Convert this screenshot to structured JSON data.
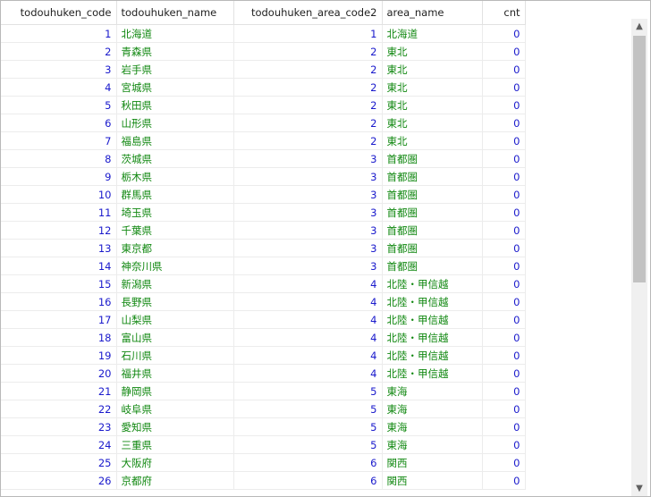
{
  "columns": [
    {
      "key": "code",
      "label": "todouhuken_code",
      "align": "num"
    },
    {
      "key": "name",
      "label": "todouhuken_name",
      "align": "txt"
    },
    {
      "key": "area_code",
      "label": "todouhuken_area_code2",
      "align": "num"
    },
    {
      "key": "area_name",
      "label": "area_name",
      "align": "txt"
    },
    {
      "key": "cnt",
      "label": "cnt",
      "align": "num"
    }
  ],
  "rows": [
    {
      "code": "1",
      "name": "北海道",
      "area_code": "1",
      "area_name": "北海道",
      "cnt": "0"
    },
    {
      "code": "2",
      "name": "青森県",
      "area_code": "2",
      "area_name": "東北",
      "cnt": "0"
    },
    {
      "code": "3",
      "name": "岩手県",
      "area_code": "2",
      "area_name": "東北",
      "cnt": "0"
    },
    {
      "code": "4",
      "name": "宮城県",
      "area_code": "2",
      "area_name": "東北",
      "cnt": "0"
    },
    {
      "code": "5",
      "name": "秋田県",
      "area_code": "2",
      "area_name": "東北",
      "cnt": "0"
    },
    {
      "code": "6",
      "name": "山形県",
      "area_code": "2",
      "area_name": "東北",
      "cnt": "0"
    },
    {
      "code": "7",
      "name": "福島県",
      "area_code": "2",
      "area_name": "東北",
      "cnt": "0"
    },
    {
      "code": "8",
      "name": "茨城県",
      "area_code": "3",
      "area_name": "首都圏",
      "cnt": "0"
    },
    {
      "code": "9",
      "name": "栃木県",
      "area_code": "3",
      "area_name": "首都圏",
      "cnt": "0"
    },
    {
      "code": "10",
      "name": "群馬県",
      "area_code": "3",
      "area_name": "首都圏",
      "cnt": "0"
    },
    {
      "code": "11",
      "name": "埼玉県",
      "area_code": "3",
      "area_name": "首都圏",
      "cnt": "0"
    },
    {
      "code": "12",
      "name": "千葉県",
      "area_code": "3",
      "area_name": "首都圏",
      "cnt": "0"
    },
    {
      "code": "13",
      "name": "東京都",
      "area_code": "3",
      "area_name": "首都圏",
      "cnt": "0"
    },
    {
      "code": "14",
      "name": "神奈川県",
      "area_code": "3",
      "area_name": "首都圏",
      "cnt": "0"
    },
    {
      "code": "15",
      "name": "新潟県",
      "area_code": "4",
      "area_name": "北陸・甲信越",
      "cnt": "0"
    },
    {
      "code": "16",
      "name": "長野県",
      "area_code": "4",
      "area_name": "北陸・甲信越",
      "cnt": "0"
    },
    {
      "code": "17",
      "name": "山梨県",
      "area_code": "4",
      "area_name": "北陸・甲信越",
      "cnt": "0"
    },
    {
      "code": "18",
      "name": "富山県",
      "area_code": "4",
      "area_name": "北陸・甲信越",
      "cnt": "0"
    },
    {
      "code": "19",
      "name": "石川県",
      "area_code": "4",
      "area_name": "北陸・甲信越",
      "cnt": "0"
    },
    {
      "code": "20",
      "name": "福井県",
      "area_code": "4",
      "area_name": "北陸・甲信越",
      "cnt": "0"
    },
    {
      "code": "21",
      "name": "静岡県",
      "area_code": "5",
      "area_name": "東海",
      "cnt": "0"
    },
    {
      "code": "22",
      "name": "岐阜県",
      "area_code": "5",
      "area_name": "東海",
      "cnt": "0"
    },
    {
      "code": "23",
      "name": "愛知県",
      "area_code": "5",
      "area_name": "東海",
      "cnt": "0"
    },
    {
      "code": "24",
      "name": "三重県",
      "area_code": "5",
      "area_name": "東海",
      "cnt": "0"
    },
    {
      "code": "25",
      "name": "大阪府",
      "area_code": "6",
      "area_name": "関西",
      "cnt": "0"
    },
    {
      "code": "26",
      "name": "京都府",
      "area_code": "6",
      "area_name": "関西",
      "cnt": "0"
    }
  ],
  "scrollbar": {
    "up_icon": "scroll-up-arrow-icon",
    "down_icon": "scroll-down-arrow-icon",
    "position": 0
  }
}
